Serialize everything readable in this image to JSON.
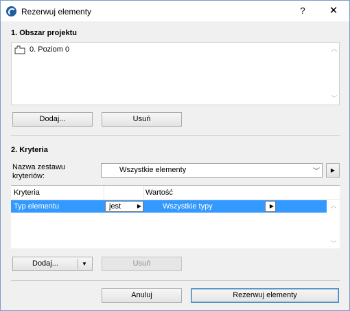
{
  "window": {
    "title": "Rezerwuj elementy",
    "help_label": "?",
    "close_label": "✕"
  },
  "area": {
    "title": "1. Obszar projektu",
    "items": [
      {
        "label": "0. Poziom 0"
      }
    ],
    "add_label": "Dodaj...",
    "remove_label": "Usuń"
  },
  "criteria": {
    "title": "2. Kryteria",
    "set_label": "Nazwa zestawu kryteriów:",
    "set_value": "Wszystkie elementy",
    "columns": [
      "Kryteria",
      "",
      "Wartość"
    ],
    "rows": [
      {
        "criterion": "Typ elementu",
        "operator": "jest",
        "value": "Wszystkie typy",
        "selected": true
      }
    ],
    "add_label": "Dodaj...",
    "remove_label": "Usuń"
  },
  "footer": {
    "cancel_label": "Anuluj",
    "confirm_label": "Rezerwuj elementy"
  },
  "colors": {
    "selection": "#3399ff",
    "window_bg": "#f0f0f0"
  }
}
